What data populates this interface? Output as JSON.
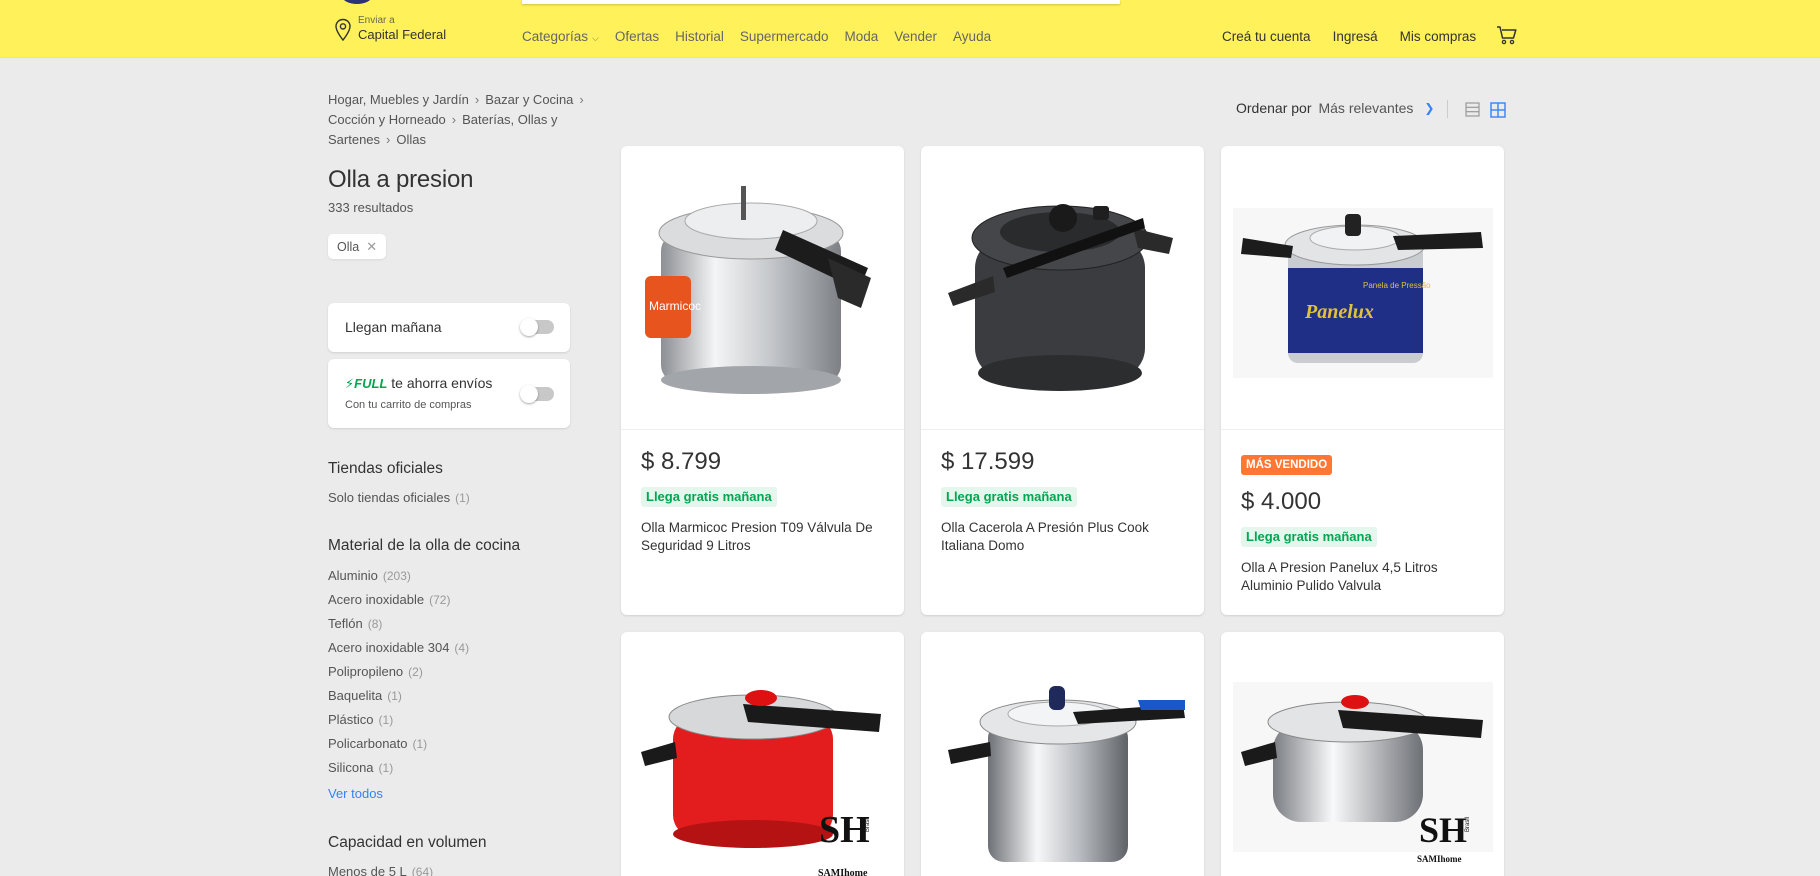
{
  "header": {
    "location_line1": "Enviar a",
    "location_line2": "Capital Federal",
    "nav": [
      "Categorías",
      "Ofertas",
      "Historial",
      "Supermercado",
      "Moda",
      "Vender",
      "Ayuda"
    ],
    "account": [
      "Creá tu cuenta",
      "Ingresá",
      "Mis compras"
    ],
    "icons": {
      "location": "location-pin-icon",
      "cart": "cart-icon"
    }
  },
  "breadcrumb": [
    "Hogar, Muebles y Jardín",
    "Bazar y Cocina",
    "Cocción y Horneado",
    "Baterías, Ollas y Sartenes",
    "Ollas"
  ],
  "search": {
    "title": "Olla a presion",
    "results": "333 resultados",
    "applied_filter": "Olla"
  },
  "filters": {
    "tomorrow_label": "Llegan mañana",
    "full_brand": "FULL",
    "full_label": "te ahorra envíos",
    "full_sub": "Con tu carrito de compras",
    "official_title": "Tiendas oficiales",
    "official_item": {
      "label": "Solo tiendas oficiales",
      "count": "(1)"
    },
    "material_title": "Material de la olla de cocina",
    "material_items": [
      {
        "label": "Aluminio",
        "count": "(203)"
      },
      {
        "label": "Acero inoxidable",
        "count": "(72)"
      },
      {
        "label": "Teflón",
        "count": "(8)"
      },
      {
        "label": "Acero inoxidable 304",
        "count": "(4)"
      },
      {
        "label": "Polipropileno",
        "count": "(2)"
      },
      {
        "label": "Baquelita",
        "count": "(1)"
      },
      {
        "label": "Plástico",
        "count": "(1)"
      },
      {
        "label": "Policarbonato",
        "count": "(1)"
      },
      {
        "label": "Silicona",
        "count": "(1)"
      }
    ],
    "ver_todos": "Ver todos",
    "capacity_title": "Capacidad en volumen",
    "capacity_item": {
      "label": "Menos de 5 L",
      "count": "(64)"
    }
  },
  "sort": {
    "label": "Ordenar por",
    "value": "Más relevantes"
  },
  "products": [
    {
      "price": "$ 8.799",
      "shipping": "Llega gratis mañana",
      "name": "Olla Marmicoc Presion T09 Válvula De Seguridad 9 Litros",
      "badge": ""
    },
    {
      "price": "$ 17.599",
      "shipping": "Llega gratis mañana",
      "name": "Olla Cacerola A Presión Plus Cook Italiana Domo",
      "badge": ""
    },
    {
      "price": "$ 4.000",
      "shipping": "Llega gratis mañana",
      "name": "Olla A Presion Panelux 4,5 Litros Aluminio Pulido Valvula",
      "badge": "MÁS VENDIDO"
    }
  ],
  "product_images": {
    "panelux_logo": "Panelux",
    "panelux_sub": "Panela de Pressão",
    "marmicoc_label": "Marmicoc",
    "sami_mark": "SH",
    "sami_brand": "SAMIhome",
    "sami_sub": "Brasil"
  }
}
